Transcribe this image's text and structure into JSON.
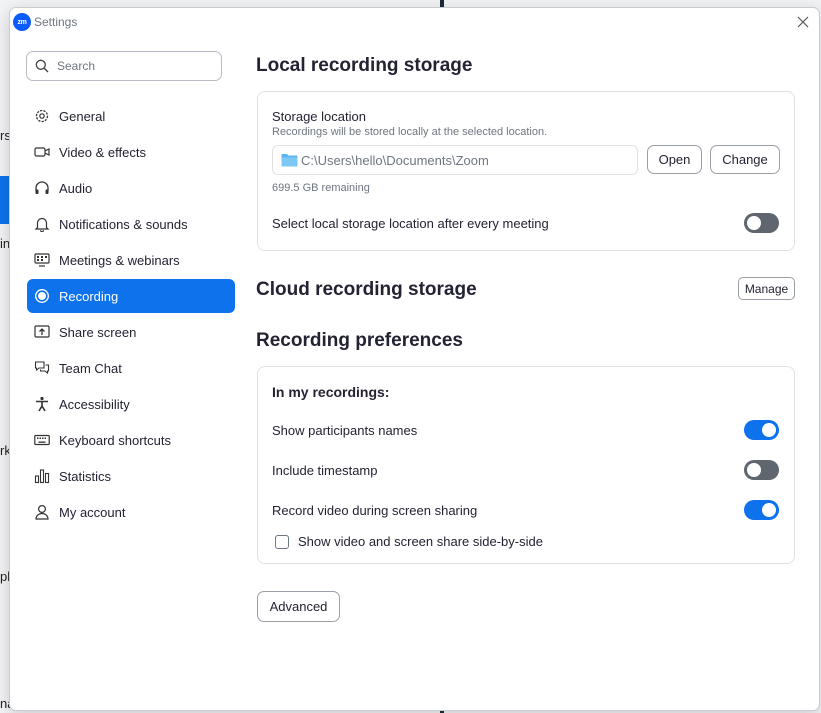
{
  "background": {
    "fragments": [
      "rs",
      "in",
      "rk",
      "pl",
      "na"
    ]
  },
  "window": {
    "logo_text": "zm",
    "title": "Settings"
  },
  "sidebar": {
    "search_placeholder": "Search",
    "items": [
      {
        "label": "General",
        "icon": "gear-icon"
      },
      {
        "label": "Video & effects",
        "icon": "video-camera-icon"
      },
      {
        "label": "Audio",
        "icon": "headphones-icon"
      },
      {
        "label": "Notifications & sounds",
        "icon": "bell-icon"
      },
      {
        "label": "Meetings & webinars",
        "icon": "meetings-icon"
      },
      {
        "label": "Recording",
        "icon": "record-icon",
        "active": true
      },
      {
        "label": "Share screen",
        "icon": "share-screen-icon"
      },
      {
        "label": "Team Chat",
        "icon": "chat-bubbles-icon"
      },
      {
        "label": "Accessibility",
        "icon": "accessibility-icon"
      },
      {
        "label": "Keyboard shortcuts",
        "icon": "keyboard-icon"
      },
      {
        "label": "Statistics",
        "icon": "bar-chart-icon"
      },
      {
        "label": "My account",
        "icon": "person-icon"
      }
    ]
  },
  "local": {
    "heading": "Local recording storage",
    "storage_label": "Storage location",
    "storage_desc": "Recordings will be stored locally at the selected location.",
    "path": "C:\\Users\\hello\\Documents\\Zoom",
    "open_label": "Open",
    "change_label": "Change",
    "remaining": "699.5 GB remaining",
    "select_after_label": "Select local storage location after every meeting",
    "select_after_on": false
  },
  "cloud": {
    "heading": "Cloud recording storage",
    "manage_label": "Manage"
  },
  "prefs": {
    "heading": "Recording preferences",
    "group_title": "In my recordings:",
    "show_names_label": "Show participants names",
    "show_names_on": true,
    "timestamp_label": "Include timestamp",
    "timestamp_on": false,
    "record_video_label": "Record video during screen sharing",
    "record_video_on": true,
    "side_by_side_label": "Show video and screen share side-by-side",
    "side_by_side_checked": false
  },
  "advanced_label": "Advanced",
  "colors": {
    "accent": "#0e72ed",
    "toggle_off": "#5f6670",
    "logo": "#0b5cff"
  }
}
